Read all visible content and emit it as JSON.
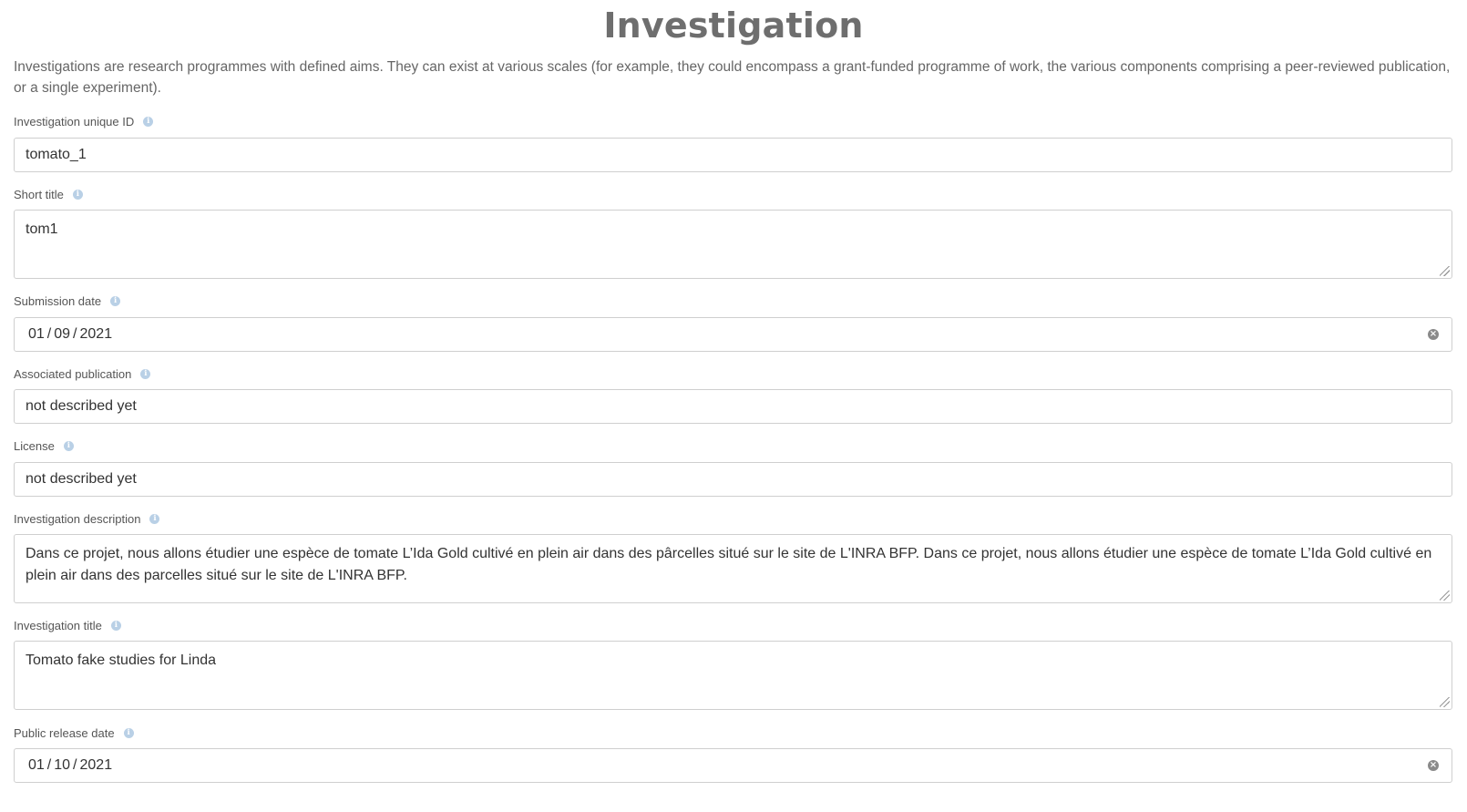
{
  "page": {
    "title": "Investigation",
    "intro": "Investigations are research programmes with defined aims. They can exist at various scales (for example, they could encompass a grant-funded programme of work, the various components comprising a peer-reviewed publication, or a single experiment)."
  },
  "fields": {
    "unique_id": {
      "label": "Investigation unique ID",
      "value": "tomato_1"
    },
    "short_title": {
      "label": "Short title",
      "value": "tom1"
    },
    "submission_date": {
      "label": "Submission date",
      "day": "01",
      "month": "09",
      "year": "2021"
    },
    "associated_publication": {
      "label": "Associated publication",
      "value": "not described yet"
    },
    "license": {
      "label": "License",
      "value": "not described yet"
    },
    "description": {
      "label": "Investigation description",
      "value": " Dans ce projet, nous allons étudier une espèce de tomate L’Ida Gold cultivé en plein air dans des pârcelles situé sur le site de L'INRA BFP.  Dans ce projet, nous allons étudier une espèce de tomate L’Ida Gold cultivé en plein air dans des parcelles situé sur le site de L'INRA BFP."
    },
    "title": {
      "label": "Investigation title",
      "value": "Tomato fake studies for Linda"
    },
    "public_release_date": {
      "label": "Public release date",
      "day": "01",
      "month": "10",
      "year": "2021"
    }
  },
  "icons": {
    "info": "info-icon",
    "clear": "clear-icon",
    "resize": "resize-grip-icon"
  },
  "colors": {
    "title": "#6e6e6e",
    "info_icon": "#b9d0e6",
    "border": "#cfcfcf",
    "spellcheck": "#d62c2c"
  }
}
